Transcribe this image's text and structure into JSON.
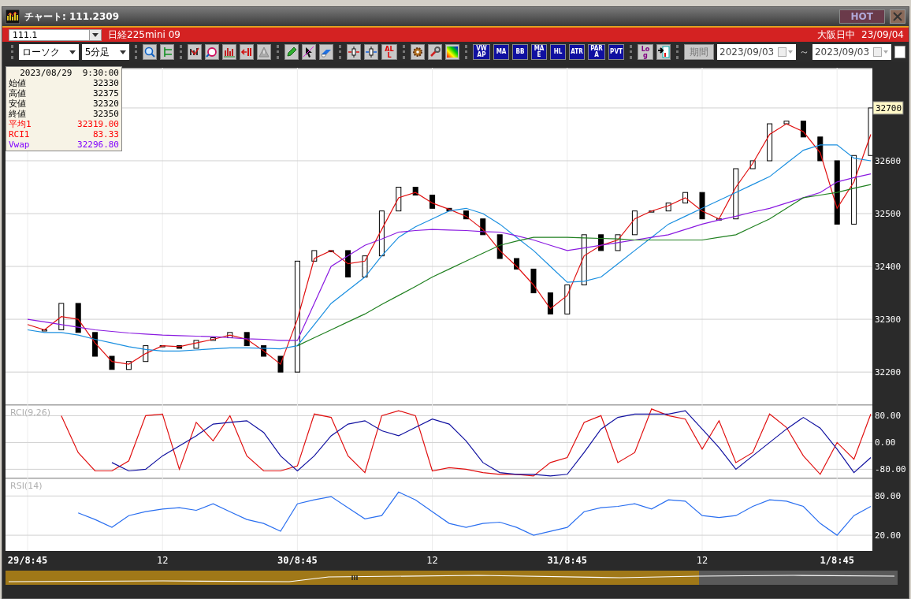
{
  "window": {
    "title": "チャート: 111.2309",
    "badge": "HOT"
  },
  "symbol_bar": {
    "code": "111.1",
    "name": "日経225mini 09",
    "session": "大阪日中",
    "date": "23/09/04"
  },
  "toolbar": {
    "chart_type": "ローソク",
    "interval": "5分足",
    "all_button": "ALL",
    "indicator_buttons": [
      "VWAP",
      "MA",
      "BB",
      "MAE",
      "HL",
      "ATR",
      "PARA",
      "PVT"
    ],
    "log_button": "Log",
    "period_button": "期間",
    "date_from": "2023/09/03",
    "range_separator": "～",
    "date_to": "2023/09/03",
    "checkbox": {
      "checked": false
    }
  },
  "info_box": {
    "datetime": "2023/08/29  9:30:00",
    "rows": [
      {
        "label": "始値",
        "value": "32330",
        "color": "#000000"
      },
      {
        "label": "高値",
        "value": "32375",
        "color": "#000000"
      },
      {
        "label": "安値",
        "value": "32320",
        "color": "#000000"
      },
      {
        "label": "終値",
        "value": "32350",
        "color": "#000000"
      },
      {
        "label": "平均1",
        "value": "32319.00",
        "color": "#ff0000"
      },
      {
        "label": "RCI1",
        "value": "83.33",
        "color": "#ff0000"
      },
      {
        "label": "Vwap",
        "value": "32296.80",
        "color": "#8000ff"
      }
    ]
  },
  "price_chart": {
    "chart_data": {
      "type": "line",
      "grid": true,
      "categories": [
        null,
        null,
        null,
        null,
        null,
        null,
        null,
        null,
        null,
        null,
        null,
        null,
        null,
        null,
        null,
        null,
        null,
        null,
        null,
        null,
        null,
        null,
        null,
        null,
        null,
        null,
        null,
        null,
        null,
        null,
        null,
        null,
        null,
        null,
        null,
        null,
        null,
        null,
        null,
        null,
        null,
        null,
        null,
        null,
        null,
        null,
        null,
        null,
        null,
        null,
        null
      ],
      "series": [
        {
          "color": "#e01010",
          "values": [
            32290,
            32280,
            32305,
            32300,
            32255,
            32220,
            32215,
            32235,
            32250,
            32248,
            32255,
            32262,
            32270,
            32262,
            32240,
            32215,
            32300,
            32415,
            32430,
            32405,
            32410,
            32470,
            32530,
            32540,
            32520,
            32508,
            32495,
            32470,
            32430,
            32400,
            32365,
            32320,
            32345,
            32420,
            32440,
            32450,
            32490,
            32505,
            32515,
            32530,
            32505,
            32490,
            32550,
            32595,
            32650,
            32670,
            32655,
            32615,
            32510,
            32560,
            32650
          ]
        },
        {
          "color": "#1a8fe0",
          "values": [
            32280,
            32275,
            32275,
            32270,
            32262,
            32255,
            32248,
            32243,
            32240,
            32240,
            32242,
            32244,
            32246,
            32246,
            32245,
            32244,
            32250,
            32290,
            32330,
            32355,
            32380,
            32420,
            32455,
            32475,
            32490,
            32505,
            32510,
            32500,
            32480,
            32455,
            32430,
            32400,
            32370,
            32372,
            32380,
            32405,
            32430,
            32455,
            32480,
            32495,
            32510,
            32525,
            32540,
            32555,
            32570,
            32595,
            32620,
            32630,
            32630,
            32605,
            32600
          ]
        },
        {
          "color": "#8a1ae0",
          "values": [
            32300,
            32295,
            32290,
            32285,
            32280,
            32277,
            32274,
            32272,
            32270,
            32269,
            32268,
            32267,
            32265,
            32263,
            32262,
            32260,
            32260,
            32330,
            32400,
            32420,
            32440,
            32452,
            32465,
            32468,
            32470,
            32469,
            32468,
            32466,
            32465,
            32458,
            32450,
            32440,
            32430,
            32435,
            32440,
            32445,
            32450,
            32455,
            32460,
            32470,
            32480,
            32488,
            32495,
            32503,
            32510,
            32520,
            32530,
            32540,
            32560,
            32568,
            32575
          ]
        },
        {
          "color": "#208020",
          "values": [
            null,
            null,
            null,
            null,
            null,
            null,
            null,
            null,
            null,
            null,
            null,
            null,
            null,
            null,
            null,
            null,
            32250,
            32265,
            32280,
            32295,
            32310,
            32328,
            32345,
            32362,
            32380,
            32395,
            32410,
            32425,
            32440,
            32448,
            32455,
            32455,
            32455,
            32454,
            32453,
            32452,
            32450,
            32450,
            32450,
            32450,
            32450,
            32455,
            32460,
            32475,
            32490,
            32510,
            32530,
            32535,
            32540,
            32548,
            32555
          ]
        }
      ],
      "ylim": [
        32139,
        32776
      ],
      "yticks": [
        {
          "value": 32200,
          "label": "32200"
        },
        {
          "value": 32300,
          "label": "32300"
        },
        {
          "value": 32400,
          "label": "32400"
        },
        {
          "value": 32500,
          "label": "32500"
        },
        {
          "value": 32600,
          "label": "32600"
        },
        {
          "value": 32700,
          "label": "32700"
        }
      ]
    }
  },
  "rci_chart": {
    "chart_data": {
      "type": "line",
      "grid": true,
      "title": "RCI(9,26)",
      "categories": [
        null,
        null,
        null,
        null,
        null,
        null,
        null,
        null,
        null,
        null,
        null,
        null,
        null,
        null,
        null,
        null,
        null,
        null,
        null,
        null,
        null,
        null,
        null,
        null,
        null,
        null,
        null,
        null,
        null,
        null,
        null,
        null,
        null,
        null,
        null,
        null,
        null,
        null,
        null,
        null,
        null,
        null,
        null,
        null,
        null,
        null,
        null,
        null,
        null,
        null,
        null
      ],
      "series": [
        {
          "color": "#e01010",
          "values": [
            null,
            null,
            80,
            -30,
            -85,
            -85,
            -55,
            80,
            85,
            -80,
            60,
            5,
            80,
            -40,
            -85,
            -85,
            -70,
            85,
            75,
            -40,
            -90,
            80,
            95,
            80,
            -85,
            -75,
            -80,
            -90,
            -95,
            -95,
            -100,
            -60,
            -45,
            60,
            80,
            -60,
            -30,
            100,
            80,
            70,
            -20,
            65,
            -60,
            -30,
            85,
            45,
            -40,
            -95,
            0,
            -50,
            85
          ]
        },
        {
          "color": "#1010a0",
          "values": [
            null,
            null,
            null,
            null,
            null,
            -60,
            -85,
            -80,
            -40,
            -10,
            20,
            55,
            60,
            65,
            30,
            -40,
            -85,
            -40,
            20,
            55,
            65,
            35,
            20,
            45,
            70,
            55,
            5,
            -60,
            -90,
            -95,
            -95,
            -100,
            -95,
            -30,
            40,
            75,
            85,
            85,
            85,
            95,
            40,
            -15,
            -80,
            -40,
            0,
            40,
            75,
            43,
            -20,
            -90,
            -45
          ]
        }
      ],
      "ylim": [
        -105,
        114
      ],
      "yticks": [
        {
          "value": 80,
          "label": "80.00"
        },
        {
          "value": 0,
          "label": "0.00"
        },
        {
          "value": -80,
          "label": "-80.00"
        }
      ]
    }
  },
  "rsi_chart": {
    "chart_data": {
      "type": "line",
      "grid": true,
      "title": "RSI(14)",
      "categories": [
        "29/8:45",
        null,
        null,
        null,
        null,
        null,
        null,
        null,
        "12",
        null,
        null,
        null,
        null,
        null,
        null,
        null,
        "30/8:45",
        null,
        null,
        null,
        null,
        null,
        null,
        null,
        "12",
        null,
        null,
        null,
        null,
        null,
        null,
        null,
        "31/8:45",
        null,
        null,
        null,
        null,
        null,
        null,
        null,
        "12",
        null,
        null,
        null,
        null,
        null,
        null,
        null,
        "1/8:45",
        null,
        null
      ],
      "series": [
        {
          "color": "#2a6ff0",
          "values": [
            null,
            null,
            null,
            54,
            44,
            32,
            50,
            56,
            60,
            62,
            58,
            68,
            56,
            44,
            38,
            26,
            68,
            74,
            79,
            62,
            45,
            50,
            86,
            74,
            56,
            38,
            32,
            38,
            40,
            32,
            20,
            26,
            32,
            56,
            62,
            64,
            68,
            60,
            74,
            72,
            50,
            47,
            50,
            64,
            74,
            72,
            64,
            38,
            20,
            50,
            64
          ]
        }
      ],
      "ylim": [
        -4,
        108
      ],
      "yticks": [
        {
          "value": 80,
          "label": "80.00"
        },
        {
          "value": 20,
          "label": "20.00"
        }
      ]
    }
  }
}
